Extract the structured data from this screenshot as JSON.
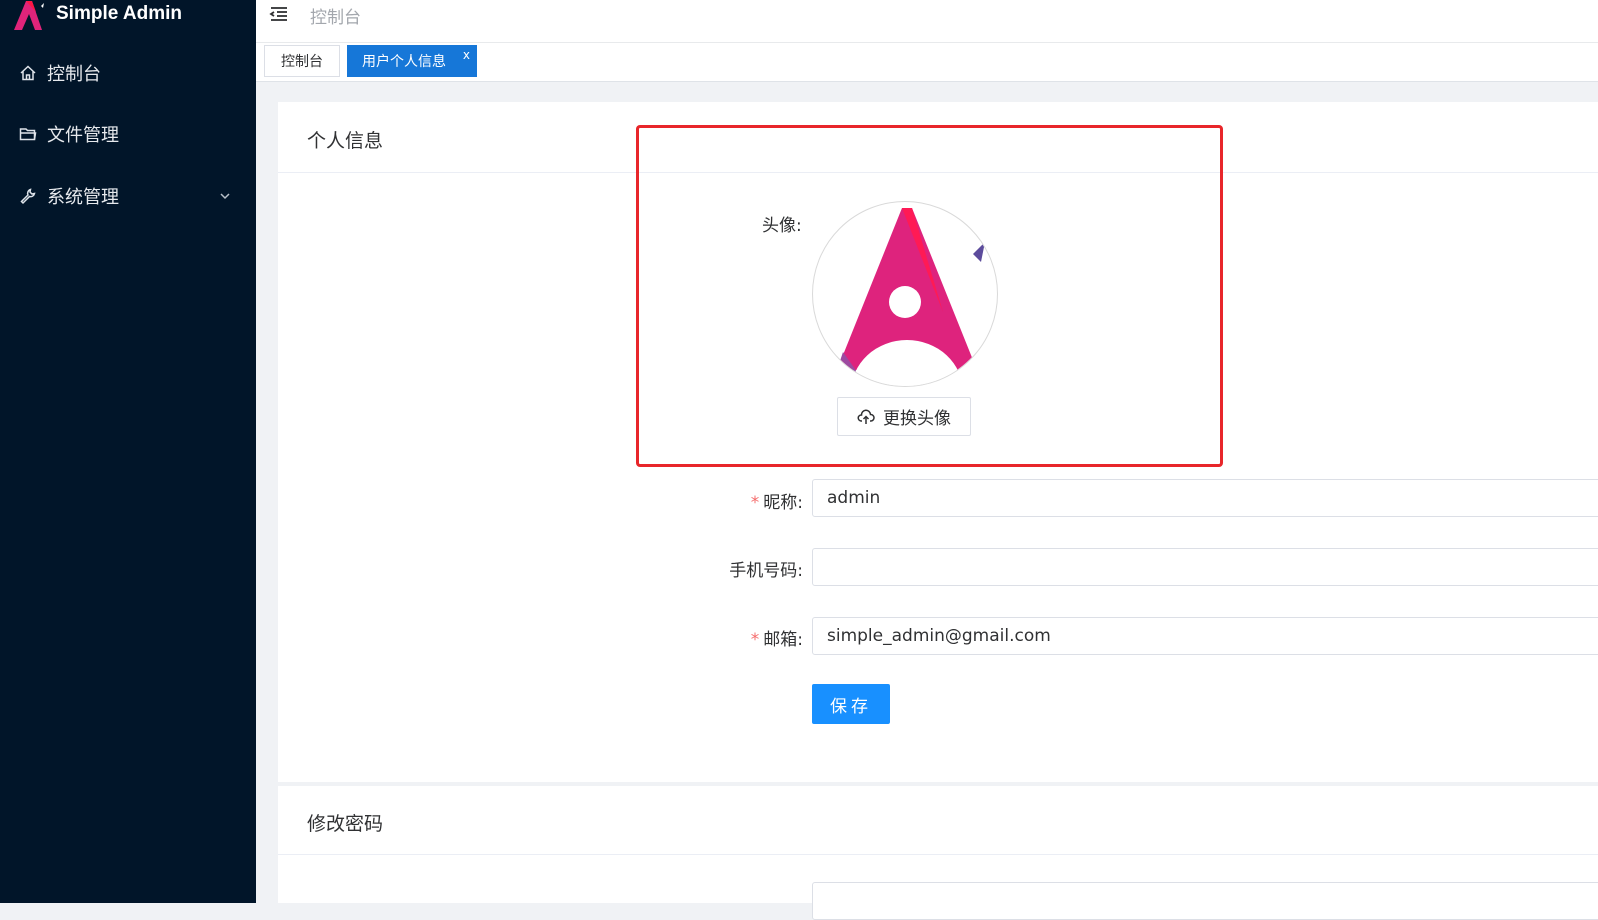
{
  "app": {
    "name": "Simple Admin",
    "accent_color": "#1890ff",
    "sidebar_bg": "#011529"
  },
  "sidebar": {
    "items": [
      {
        "label": "控制台",
        "icon": "home-icon"
      },
      {
        "label": "文件管理",
        "icon": "folder-icon"
      },
      {
        "label": "系统管理",
        "icon": "wrench-icon",
        "expandable": true
      }
    ]
  },
  "header": {
    "breadcrumb": "控制台"
  },
  "tabs": [
    {
      "label": "控制台",
      "active": false
    },
    {
      "label": "用户个人信息",
      "active": true,
      "close": "x"
    }
  ],
  "profile": {
    "section_title": "个人信息",
    "avatar_label": "头像:",
    "upload_button": "更换头像",
    "fields": {
      "nickname": {
        "label": "昵称:",
        "value": "admin",
        "required": true,
        "required_mark": "*"
      },
      "phone": {
        "label": "手机号码:",
        "value": "",
        "required": false
      },
      "email": {
        "label": "邮箱:",
        "value": "simple_admin@gmail.com",
        "required": true,
        "required_mark": "*"
      }
    },
    "save_button": "保存"
  },
  "password_section": {
    "title": "修改密码"
  },
  "annotation": {
    "highlight_color": "#e8262a"
  }
}
